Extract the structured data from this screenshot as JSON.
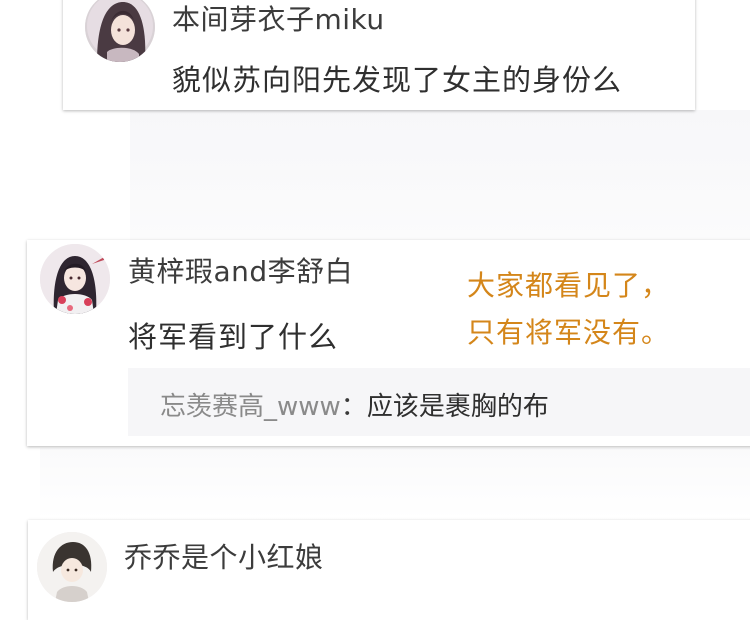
{
  "comments": [
    {
      "username": "本间芽衣子miku",
      "text": "貌似苏向阳先发现了女主的身份么",
      "avatar_icon": "anime-girl-avatar-icon"
    },
    {
      "username": "黄梓瑕and李舒白",
      "text": "将军看到了什么",
      "avatar_icon": "anime-girl-avatar-icon",
      "reply": {
        "user": "忘羡赛高_www",
        "separator": "：",
        "text": "应该是裹胸的布"
      }
    },
    {
      "username": "乔乔是个小红娘",
      "avatar_icon": "anime-boy-avatar-icon"
    }
  ],
  "annotation": {
    "line1": "大家都看见了，",
    "line2": "只有将军没有。",
    "color": "#d4861a"
  }
}
